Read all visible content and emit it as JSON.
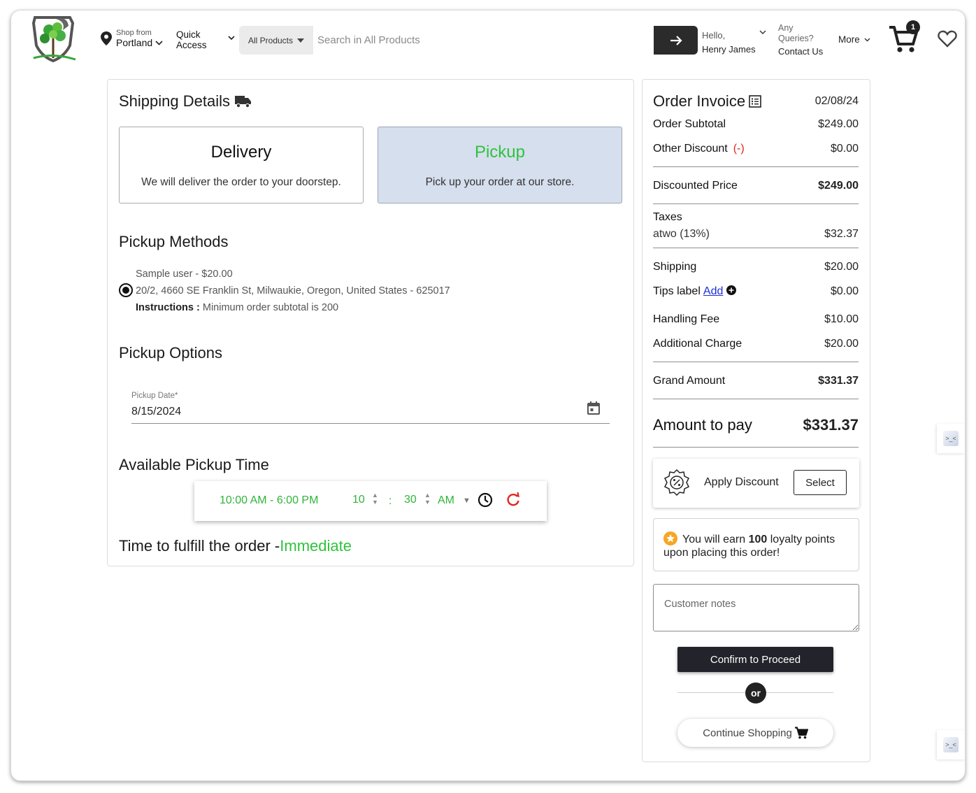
{
  "header": {
    "location_small": "Shop from",
    "location_city": "Portland",
    "quick_access_line1": "Quick",
    "quick_access_line2": "Access",
    "search_category": "All Products",
    "search_placeholder": "Search in All Products",
    "hello_label": "Hello,",
    "user_name": "Henry James",
    "queries_line1": "Any",
    "queries_line2": "Queries?",
    "contact_label": "Contact Us",
    "more_label": "More",
    "cart_count": "1"
  },
  "shipping": {
    "title": "Shipping Details",
    "delivery": {
      "title": "Delivery",
      "desc": "We will deliver the order to your doorstep."
    },
    "pickup": {
      "title": "Pickup",
      "desc": "Pick up your order at our store."
    },
    "methods_title": "Pickup Methods",
    "method": {
      "name": "Sample user - $20.00",
      "address": "20/2, 4660 SE Franklin St, Milwaukie, Oregon, United States - 625017",
      "instructions_label": "Instructions :",
      "instructions": "Minimum order subtotal is 200"
    },
    "options_title": "Pickup Options",
    "date_label": "Pickup Date*",
    "date_value": "8/15/2024",
    "time_title": "Available Pickup Time",
    "time_range": "10:00 AM - 6:00 PM",
    "hour": "10",
    "colon": ":",
    "minute": "30",
    "ampm": "AM",
    "fulfill_label": "Time to fulfill the order -",
    "fulfill_value": "Immediate"
  },
  "invoice": {
    "title": "Order Invoice",
    "date": "02/08/24",
    "subtotal_label": "Order Subtotal",
    "subtotal": "$249.00",
    "discount_label": "Other Discount",
    "discount_sign": "(-)",
    "discount": "$0.00",
    "discounted_label": "Discounted Price",
    "discounted": "$249.00",
    "taxes_label": "Taxes",
    "tax_name": "atwo (13%)",
    "tax_value": "$32.37",
    "shipping_label": "Shipping",
    "shipping": "$20.00",
    "tips_label": "Tips label",
    "tips_add": "Add",
    "tips": "$0.00",
    "handling_label": "Handling Fee",
    "handling": "$10.00",
    "additional_label": "Additional Charge",
    "additional": "$20.00",
    "grand_label": "Grand Amount",
    "grand": "$331.37",
    "pay_label": "Amount to pay",
    "pay": "$331.37",
    "apply_discount": "Apply Discount",
    "select_label": "Select",
    "loyalty_pre": "You will earn",
    "loyalty_points": "100",
    "loyalty_post": "loyalty points upon placing this order!",
    "notes_placeholder": "Customer notes",
    "confirm_label": "Confirm to Proceed",
    "or_label": "or",
    "continue_label": "Continue Shopping"
  },
  "colors": {
    "accent_green": "#2fc23c",
    "dark": "#23232b",
    "selected_bg": "#d6dfee",
    "negative": "#e1251b"
  }
}
